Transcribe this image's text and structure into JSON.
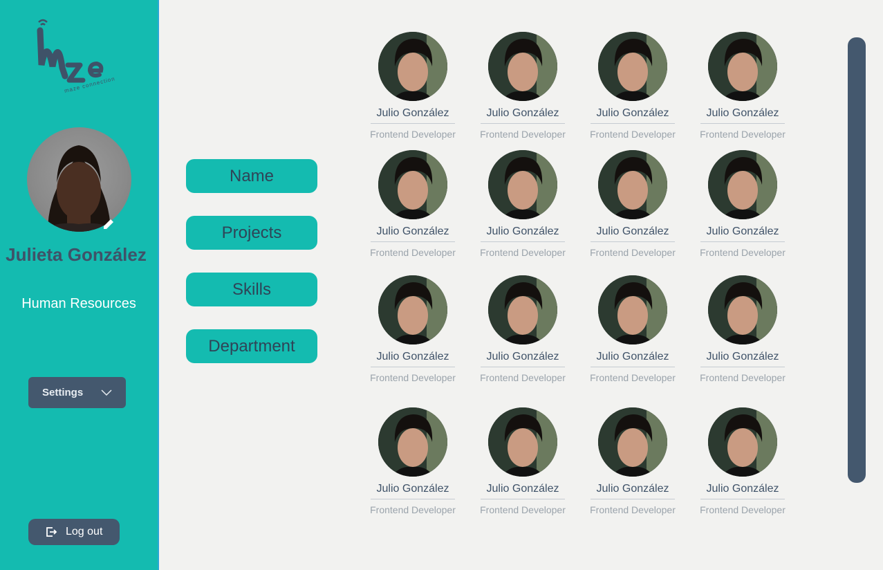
{
  "sidebar": {
    "logo_text": "maze connection",
    "user": {
      "name": "Julieta González",
      "role": "Human Resources"
    },
    "settings_label": "Settings",
    "logout_label": "Log out"
  },
  "filters": [
    {
      "label": "Name"
    },
    {
      "label": "Projects"
    },
    {
      "label": "Skills"
    },
    {
      "label": "Department"
    }
  ],
  "people": [
    {
      "name": "Julio González",
      "title": "Frontend Developer"
    },
    {
      "name": "Julio González",
      "title": "Frontend Developer"
    },
    {
      "name": "Julio González",
      "title": "Frontend Developer"
    },
    {
      "name": "Julio González",
      "title": "Frontend Developer"
    },
    {
      "name": "Julio González",
      "title": "Frontend Developer"
    },
    {
      "name": "Julio González",
      "title": "Frontend Developer"
    },
    {
      "name": "Julio González",
      "title": "Frontend Developer"
    },
    {
      "name": "Julio González",
      "title": "Frontend Developer"
    },
    {
      "name": "Julio González",
      "title": "Frontend Developer"
    },
    {
      "name": "Julio González",
      "title": "Frontend Developer"
    },
    {
      "name": "Julio González",
      "title": "Frontend Developer"
    },
    {
      "name": "Julio González",
      "title": "Frontend Developer"
    },
    {
      "name": "Julio González",
      "title": "Frontend Developer"
    },
    {
      "name": "Julio González",
      "title": "Frontend Developer"
    },
    {
      "name": "Julio González",
      "title": "Frontend Developer"
    },
    {
      "name": "Julio González",
      "title": "Frontend Developer"
    }
  ],
  "icons": {
    "edit": "pencil-icon",
    "settings_dropdown": "chevron-down-icon",
    "logout": "logout-icon"
  },
  "colors": {
    "sidebar": "#14bbb0",
    "accent_dark": "#44586e",
    "text_dark": "#3f5268",
    "background": "#f2f2f0"
  }
}
